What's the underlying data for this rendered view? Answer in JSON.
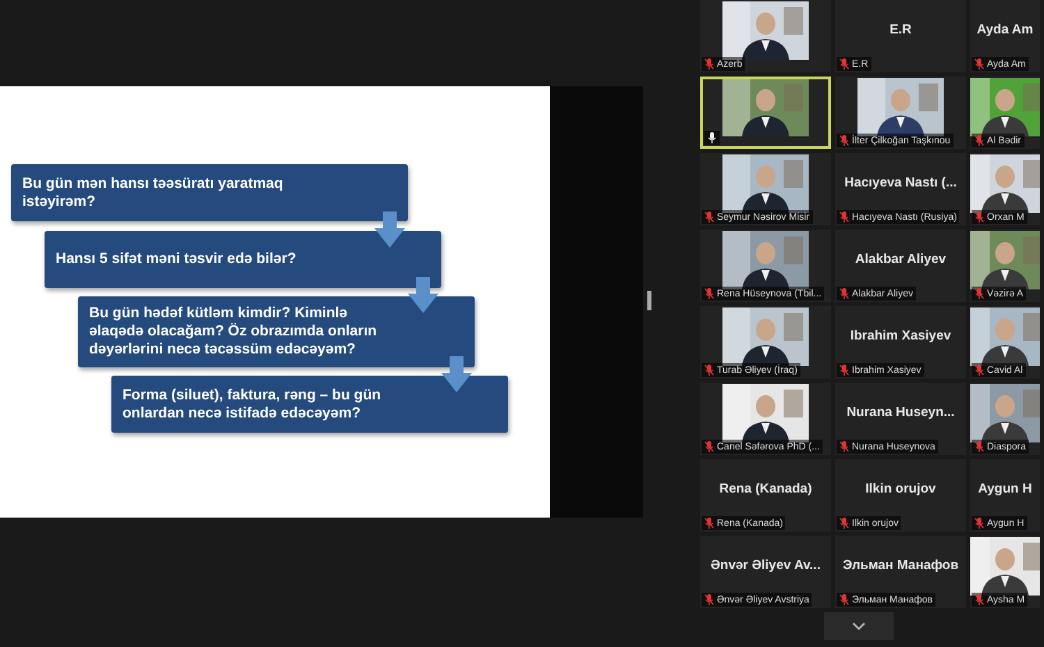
{
  "shared_screen": {
    "slide": {
      "boxes": [
        "Bu gün mən hansı təəsüratı yaratmaq istəyirəm?",
        "Hansı 5 sifət məni təsvir edə bilər?",
        "Bu gün hədəf kütləm kimdir? Kiminlə əlaqədə olacağam? Öz obrazımda onların dəyərlərini necə təcəssüm edəcəyəm?",
        "Forma (siluet), faktura, rəng – bu gün onlardan necə istifadə edəcəyəm?"
      ]
    }
  },
  "participants": [
    {
      "kind": "video",
      "label": "Azerb",
      "muted": true,
      "speaking": false
    },
    {
      "kind": "name",
      "title": "E.R",
      "label": "E.R",
      "muted": true,
      "speaking": false
    },
    {
      "kind": "name",
      "title": "Ayda Am",
      "label": "Ayda Am",
      "muted": true,
      "speaking": false
    },
    {
      "kind": "video",
      "muted": false,
      "speaking": true
    },
    {
      "kind": "video",
      "label": "İlter Çilkoğan Taşkınou",
      "muted": true,
      "speaking": false
    },
    {
      "kind": "video",
      "label": "Al Bədir",
      "muted": true,
      "speaking": false
    },
    {
      "kind": "video",
      "label": "Seymur Nəsirov Misir",
      "muted": true,
      "speaking": false
    },
    {
      "kind": "name",
      "title": "Hacıyeva Nastı (...",
      "label": "Hacıyeva Nastı (Rusiya)",
      "muted": true,
      "speaking": false
    },
    {
      "kind": "video",
      "label": "Orxan M",
      "muted": true,
      "speaking": false
    },
    {
      "kind": "video",
      "label": "Rena Hüseynova (Tbil...",
      "muted": true,
      "speaking": false
    },
    {
      "kind": "name",
      "title": "Alakbar Aliyev",
      "label": "Alakbar Aliyev",
      "muted": true,
      "speaking": false
    },
    {
      "kind": "video",
      "label": "Vəzirə A",
      "muted": true,
      "speaking": false
    },
    {
      "kind": "video",
      "label": "Turab Əliyev (İraq)",
      "muted": true,
      "speaking": false
    },
    {
      "kind": "name",
      "title": "Ibrahim Xasiyev",
      "label": "Ibrahim Xasiyev",
      "muted": true,
      "speaking": false
    },
    {
      "kind": "video",
      "label": "Cavid Al",
      "muted": true,
      "speaking": false
    },
    {
      "kind": "video",
      "label": "Canel Səfərova PhD (...",
      "muted": true,
      "speaking": false
    },
    {
      "kind": "name",
      "title": "Nurana  Huseyn...",
      "label": "Nurana Huseynova",
      "muted": true,
      "speaking": false
    },
    {
      "kind": "video",
      "label": "Diaspora",
      "muted": true,
      "speaking": false
    },
    {
      "kind": "name",
      "title": "Rena (Kanada)",
      "label": "Rena (Kanada)",
      "muted": true,
      "speaking": false
    },
    {
      "kind": "name",
      "title": "Ilkin orujov",
      "label": "Ilkin orujov",
      "muted": true,
      "speaking": false
    },
    {
      "kind": "name",
      "title": "Aygun H",
      "label": "Aygun H",
      "muted": true,
      "speaking": false
    },
    {
      "kind": "name",
      "title": "Ənvər Əliyev Av...",
      "label": "Ənvər Əliyev Avstriya",
      "muted": true,
      "speaking": false
    },
    {
      "kind": "name",
      "title": "Эльман Манафов",
      "label": "Эльман Манафов",
      "muted": true,
      "speaking": false
    },
    {
      "kind": "video",
      "label": "Aysha M",
      "muted": true,
      "speaking": false
    }
  ]
}
